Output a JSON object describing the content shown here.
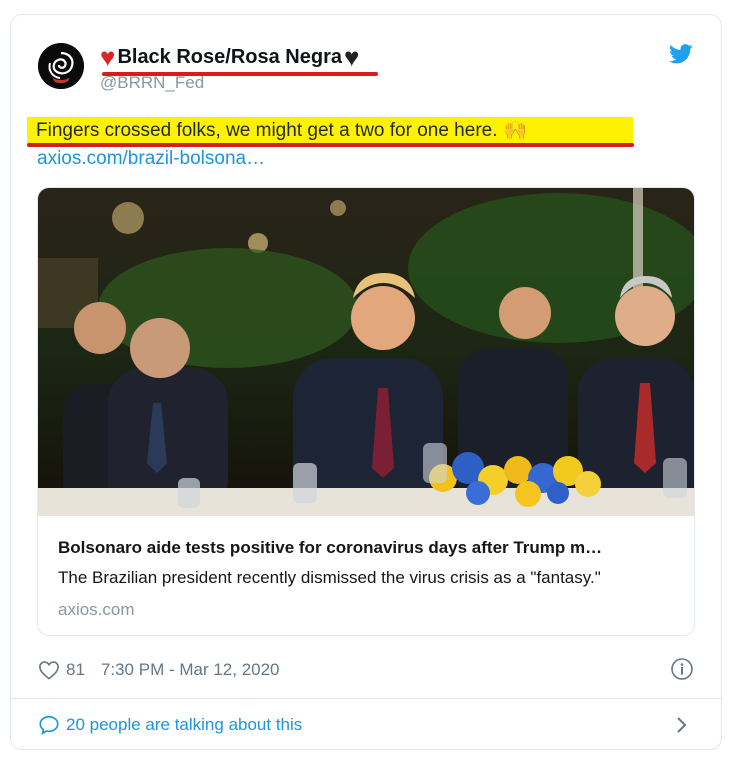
{
  "tweet": {
    "display_name": "Black Rose/Rosa Negra",
    "handle": "@BRRN_Fed",
    "text": "Fingers crossed folks, we might get a two for one here.",
    "emoji": "🙌",
    "link": "axios.com/brazil-bolsona…",
    "timestamp": "7:30 PM - Mar 12, 2020",
    "likes": "81",
    "talking": "20 people are talking about this"
  },
  "card": {
    "title": "Bolsonaro aide tests positive for coronavirus days after Trump m…",
    "description": "The Brazilian president recently dismissed the virus crisis as a \"fantasy.\"",
    "domain": "axios.com"
  },
  "icons": {
    "avatar": "black-rose-logo",
    "brand": "twitter-bird-icon",
    "like": "heart-outline-icon",
    "info": "info-icon",
    "talk": "speech-bubble-icon",
    "chevron": "chevron-right-icon"
  },
  "colors": {
    "link": "#1b95e0",
    "highlight": "#fff200",
    "annotation": "#d61d1d",
    "muted": "#657786"
  }
}
